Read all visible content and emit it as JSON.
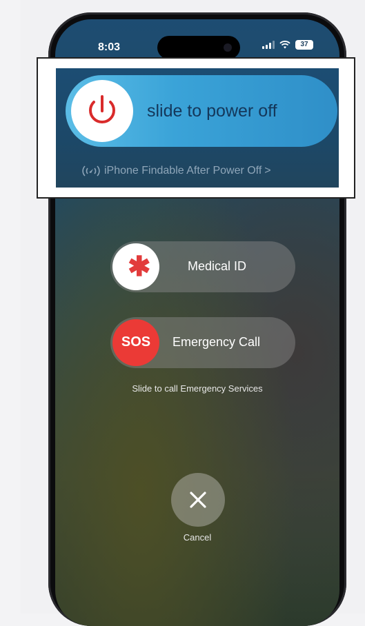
{
  "status_bar": {
    "time": "8:03",
    "battery": "37"
  },
  "power": {
    "slider_label": "slide to power off",
    "findable_text": "iPhone Findable After Power Off",
    "accent_color": "#3aa3d8"
  },
  "medical": {
    "label": "Medical ID"
  },
  "emergency": {
    "sos_label": "SOS",
    "label": "Emergency Call",
    "hint": "Slide to call Emergency Services",
    "color": "#eb3a36"
  },
  "cancel": {
    "label": "Cancel"
  }
}
